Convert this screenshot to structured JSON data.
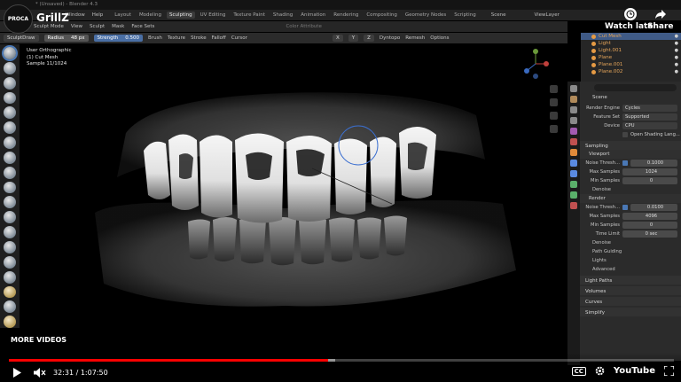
{
  "window": {
    "title": "* (Unsaved) - Blender 4.3"
  },
  "menu": {
    "items": [
      "Window",
      "Help"
    ],
    "workspaces": [
      "Layout",
      "Modeling",
      "Sculpting",
      "UV Editing",
      "Texture Paint",
      "Shading",
      "Animation",
      "Rendering",
      "Compositing",
      "Geometry Nodes",
      "Scripting"
    ],
    "active_workspace": "Sculpting",
    "scene": "Scene",
    "view_layer": "ViewLayer"
  },
  "mode_header": {
    "mode": "Sculpt Mode",
    "items": [
      "View",
      "Sculpt",
      "Mask",
      "Face Sets"
    ],
    "search_placeholder": "Color Attribute"
  },
  "tool_header": {
    "brush": "SculptDraw",
    "radius_label": "Radius",
    "radius_value": "48 px",
    "strength_label": "Strength",
    "strength_value": "0.500",
    "menus": [
      "Brush",
      "Texture",
      "Stroke",
      "Falloff",
      "Cursor"
    ],
    "axes": [
      "X",
      "Y",
      "Z"
    ],
    "dyntopo": "Dyntopo",
    "remesh": "Remesh",
    "options": "Options"
  },
  "viewport": {
    "view_name": "User Orthographic",
    "object": "(1) Cut Mesh",
    "sample": "Sample 11/1024"
  },
  "outliner": {
    "items": [
      {
        "label": "Cut Mesh",
        "selected": true
      },
      {
        "label": "Light",
        "selected": false
      },
      {
        "label": "Light.001",
        "selected": false
      },
      {
        "label": "Plane",
        "selected": false
      },
      {
        "label": "Plane.001",
        "selected": false
      },
      {
        "label": "Plane.002",
        "selected": false
      }
    ]
  },
  "properties": {
    "scene": "Scene",
    "render_engine_label": "Render Engine",
    "render_engine": "Cycles",
    "feature_set_label": "Feature Set",
    "feature_set": "Supported",
    "device_label": "Device",
    "device": "CPU",
    "open_shading": "Open Shading Lang...",
    "sampling": "Sampling",
    "viewport": "Viewport",
    "noise_thresh_label": "Noise Thresh...",
    "viewport_noise": "0.1000",
    "max_samples_label": "Max Samples",
    "viewport_max": "1024",
    "min_samples_label": "Min Samples",
    "viewport_min": "0",
    "denoise": "Denoise",
    "render": "Render",
    "render_noise": "0.0100",
    "render_max": "4096",
    "render_min": "0",
    "time_limit_label": "Time Limit",
    "time_limit": "0 sec",
    "path_guiding": "Path Guiding",
    "lights": "Lights",
    "advanced": "Advanced",
    "light_paths": "Light Paths",
    "volumes": "Volumes",
    "curves": "Curves",
    "simplify": "Simplify"
  },
  "youtube": {
    "channel_badge": "PROCA",
    "video_title": "GrillZ",
    "watch_later": "Watch later",
    "share": "Share",
    "more_videos": "MORE VIDEOS",
    "time": "32:31 / 1:07:50",
    "progress": 0.48,
    "buffered": 0.49,
    "cc": "CC",
    "logo": "YouTube"
  },
  "colors": {
    "accent": "#4a78b5",
    "progress": "#ff0000",
    "object_orange": "#e5a55a"
  }
}
